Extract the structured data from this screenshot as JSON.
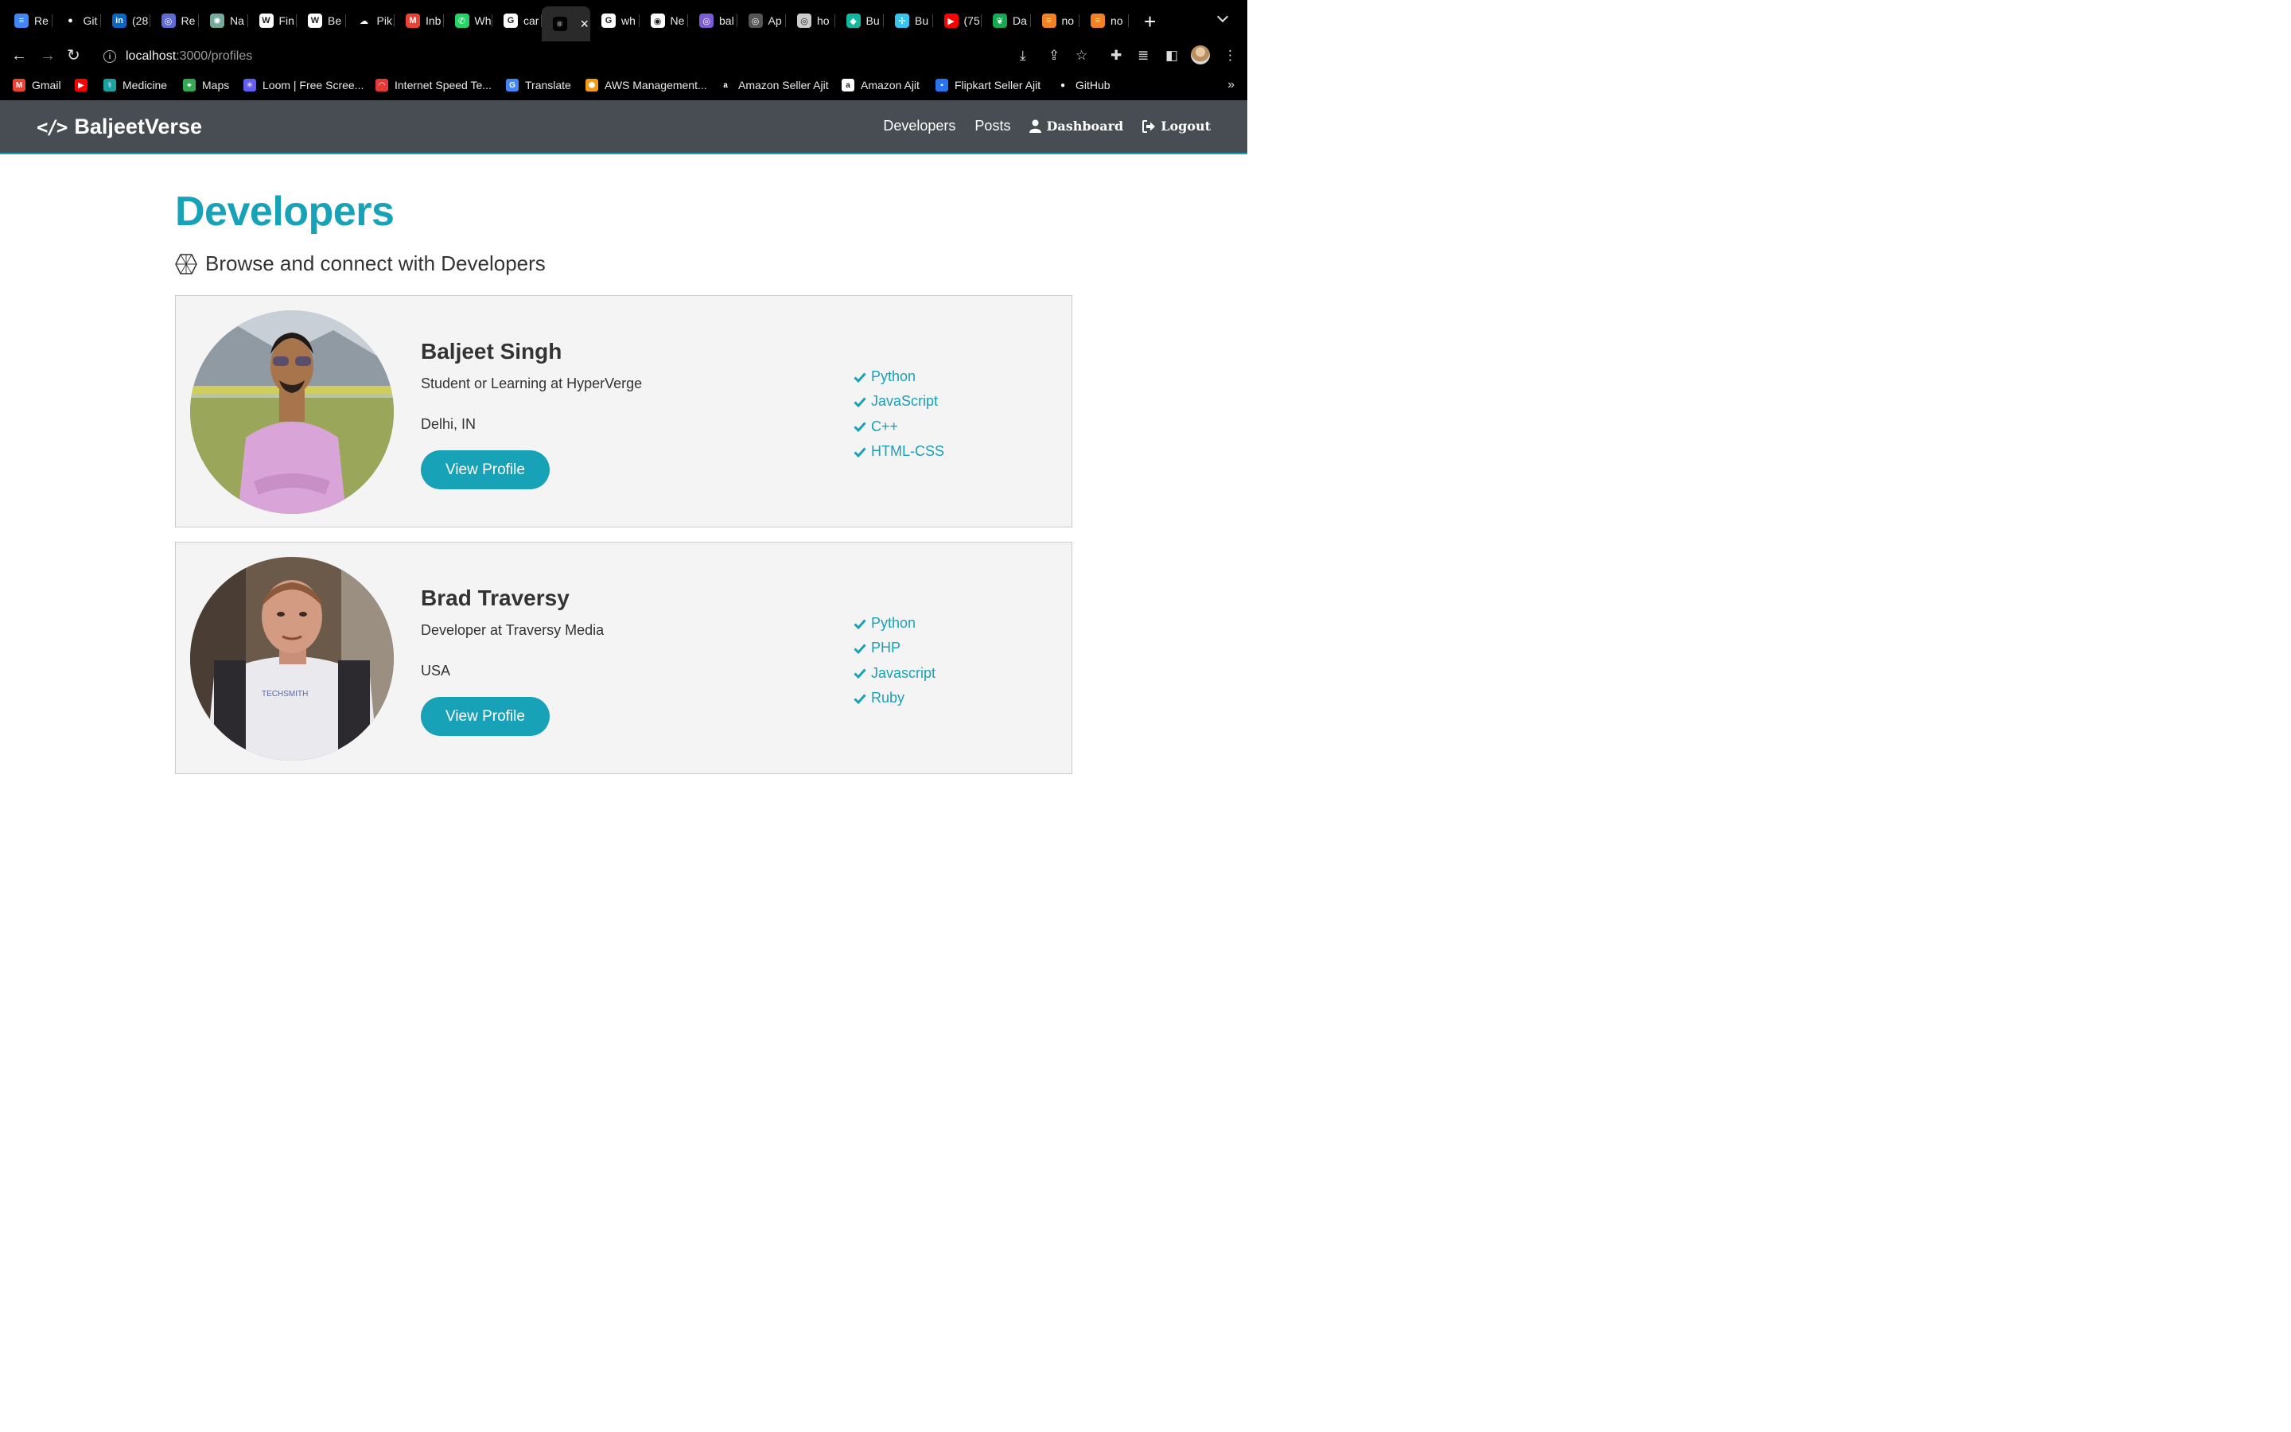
{
  "browser": {
    "tabs": [
      {
        "title": "Re",
        "favicon": "docs-icon",
        "color": "#4285f4",
        "glyph": "≡"
      },
      {
        "title": "Git",
        "favicon": "github-icon",
        "color": "#000000",
        "glyph": "●"
      },
      {
        "title": "(28",
        "favicon": "linkedin-icon",
        "color": "#0a66c2",
        "glyph": "in"
      },
      {
        "title": "Re",
        "favicon": "globe-icon",
        "color": "#5f6bd6",
        "glyph": "◎"
      },
      {
        "title": "Na",
        "favicon": "openai-icon",
        "color": "#74aa9c",
        "glyph": "✺"
      },
      {
        "title": "Fin",
        "favicon": "w-icon",
        "color": "#ffffff",
        "glyph": "W"
      },
      {
        "title": "Be",
        "favicon": "w-icon",
        "color": "#ffffff",
        "glyph": "W"
      },
      {
        "title": "Pik",
        "favicon": "cloud-icon",
        "color": "#000000",
        "glyph": "☁"
      },
      {
        "title": "Inb",
        "favicon": "gmail-icon",
        "color": "#ea4335",
        "glyph": "M"
      },
      {
        "title": "Wh",
        "favicon": "whatsapp-icon",
        "color": "#25d366",
        "glyph": "✆"
      },
      {
        "title": "car",
        "favicon": "google-icon",
        "color": "#ffffff",
        "glyph": "G"
      },
      {
        "title": "",
        "favicon": "react-icon",
        "color": "#000000",
        "glyph": "⚛",
        "active": true
      },
      {
        "title": "wh",
        "favicon": "google-icon",
        "color": "#ffffff",
        "glyph": "G"
      },
      {
        "title": "Ne",
        "favicon": "chrome-icon",
        "color": "#ffffff",
        "glyph": "◉"
      },
      {
        "title": "bal",
        "favicon": "globe-icon",
        "color": "#7b5bd6",
        "glyph": "◎"
      },
      {
        "title": "Ap",
        "favicon": "globe-icon",
        "color": "#555555",
        "glyph": "◎"
      },
      {
        "title": "ho",
        "favicon": "globe-icon",
        "color": "#cccccc",
        "glyph": "◎"
      },
      {
        "title": "Bu",
        "favicon": "diamond-icon",
        "color": "#11b8a0",
        "glyph": "◆"
      },
      {
        "title": "Bu",
        "favicon": "slack-icon",
        "color": "#36c5f0",
        "glyph": "✢"
      },
      {
        "title": "(75",
        "favicon": "youtube-icon",
        "color": "#ff0000",
        "glyph": "▶"
      },
      {
        "title": "Da",
        "favicon": "mongodb-icon",
        "color": "#13aa52",
        "glyph": "❦"
      },
      {
        "title": "no",
        "favicon": "stackoverflow-icon",
        "color": "#f48024",
        "glyph": "≡"
      },
      {
        "title": "no",
        "favicon": "stackoverflow-icon",
        "color": "#f48024",
        "glyph": "≡"
      }
    ],
    "url_host": "localhost",
    "url_path": ":3000/profiles",
    "bookmarks": [
      {
        "label": "Gmail",
        "favicon": "gmail-icon",
        "color": "#ea4335",
        "glyph": "M"
      },
      {
        "label": "",
        "favicon": "youtube-icon",
        "color": "#ff0000",
        "glyph": "▶"
      },
      {
        "label": "Medicine",
        "favicon": "medicine-icon",
        "color": "#1da1a1",
        "glyph": "⚕"
      },
      {
        "label": "Maps",
        "favicon": "maps-icon",
        "color": "#34a853",
        "glyph": "⌖"
      },
      {
        "label": "Loom | Free Scree...",
        "favicon": "loom-icon",
        "color": "#625df5",
        "glyph": "✳"
      },
      {
        "label": "Internet Speed Te...",
        "favicon": "speedtest-icon",
        "color": "#e53935",
        "glyph": "◠"
      },
      {
        "label": "Translate",
        "favicon": "translate-icon",
        "color": "#4285f4",
        "glyph": "G"
      },
      {
        "label": "AWS Management...",
        "favicon": "aws-icon",
        "color": "#f39c12",
        "glyph": "⬢"
      },
      {
        "label": "Amazon Seller Ajit",
        "favicon": "amazon-icon",
        "color": "#000000",
        "glyph": "a"
      },
      {
        "label": "Amazon Ajit",
        "favicon": "amazon-icon",
        "color": "#ffffff",
        "glyph": "a"
      },
      {
        "label": "Flipkart Seller Ajit",
        "favicon": "flipkart-icon",
        "color": "#2874f0",
        "glyph": "▪"
      },
      {
        "label": "GitHub",
        "favicon": "github-icon",
        "color": "#000000",
        "glyph": "●"
      }
    ],
    "bookmarks_more": "»"
  },
  "app": {
    "brand": "BaljeetVerse",
    "nav": {
      "developers": "Developers",
      "posts": "Posts",
      "dashboard": "Dashboard",
      "logout": "Logout"
    },
    "page_title": "Developers",
    "lead": "Browse and connect with Developers",
    "profiles": [
      {
        "name": "Baljeet Singh",
        "status": "Student or Learning at HyperVerge",
        "location": "Delhi, IN",
        "button": "View Profile",
        "skills": [
          "Python",
          "JavaScript",
          "C++",
          "HTML-CSS"
        ]
      },
      {
        "name": "Brad Traversy",
        "status": "Developer at Traversy Media",
        "location": "USA",
        "button": "View Profile",
        "skills": [
          "Python",
          "PHP",
          "Javascript",
          "Ruby"
        ]
      }
    ]
  },
  "colors": {
    "primary": "#17a2b8",
    "navbar": "#474d52",
    "card_bg": "#f4f4f4"
  }
}
